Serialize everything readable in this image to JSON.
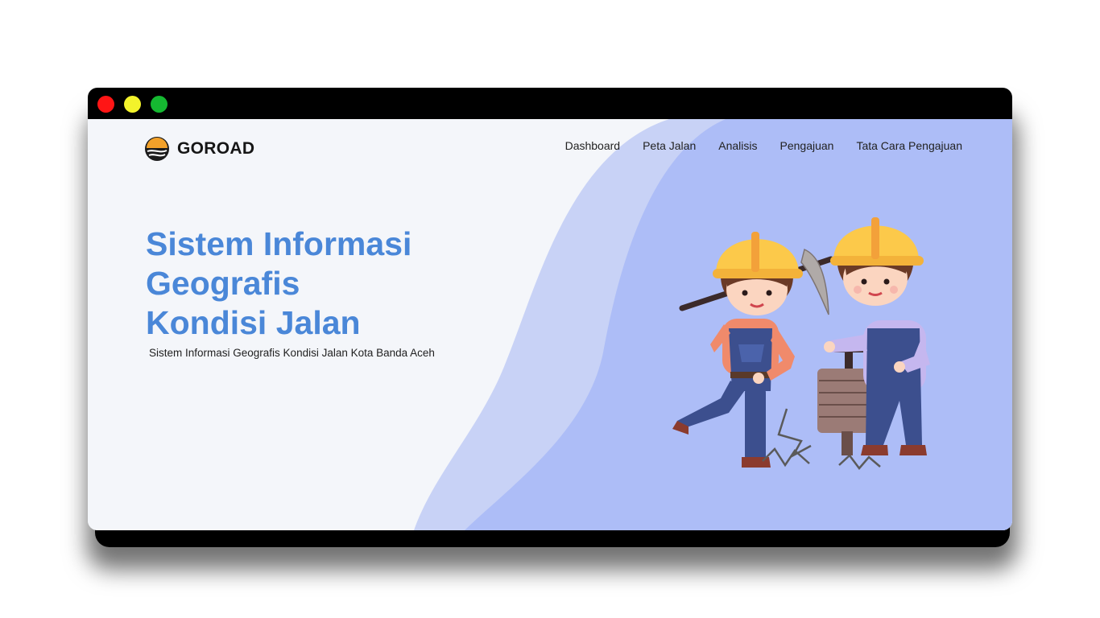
{
  "window": {
    "controls": [
      "close-icon",
      "minimize-icon",
      "maximize-icon"
    ]
  },
  "brand": {
    "name": "GOROAD",
    "logo_icon": "road-sunset-logo-icon"
  },
  "nav": {
    "items": [
      {
        "label": "Dashboard"
      },
      {
        "label": "Peta Jalan"
      },
      {
        "label": "Analisis"
      },
      {
        "label": "Pengajuan"
      },
      {
        "label": "Tata Cara Pengajuan"
      }
    ]
  },
  "hero": {
    "title_lines": [
      "Sistem Informasi",
      "Geografis",
      "Kondisi Jalan"
    ],
    "subtitle": "Sistem Informasi Geografis Kondisi Jalan Kota Banda Aceh"
  },
  "illustration": {
    "subject": "road-workers-illustration"
  },
  "colors": {
    "accent": "#4a87d8",
    "shape_light": "#c8d2f6",
    "shape_main": "#adbdf7",
    "background": "#f4f6fa"
  }
}
